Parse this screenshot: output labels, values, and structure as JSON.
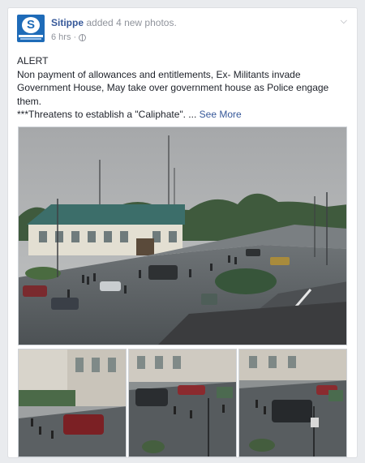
{
  "post": {
    "page_name": "Sitippe",
    "action": "added 4 new photos.",
    "time": "6 hrs",
    "separator": "·",
    "privacy_icon": "globe-icon",
    "menu_icon": "chevron-down-icon",
    "avatar_letter": "S"
  },
  "content": {
    "line1": "ALERT",
    "line2": "Non payment of allowances and entitlements, Ex- Militants invade Government House, May take over government house as Police engage them.",
    "line3": "***Threatens to establish a \"Caliphate\". ...",
    "see_more": "See More"
  },
  "colors": {
    "link": "#365899",
    "meta": "#90949c",
    "brand": "#1e6bb8"
  }
}
